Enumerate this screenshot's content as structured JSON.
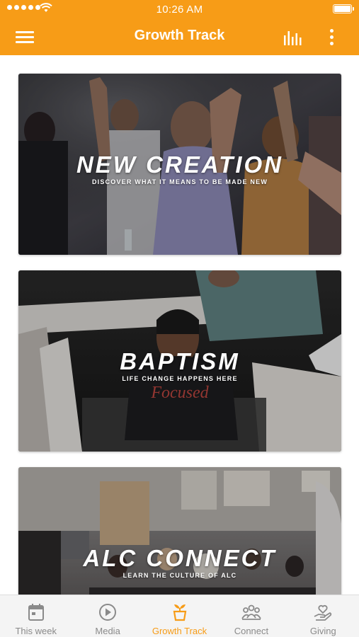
{
  "status_bar": {
    "time": "10:26 AM"
  },
  "header": {
    "title": "Growth Track"
  },
  "cards": [
    {
      "title": "NEW CREATION",
      "subtitle": "DISCOVER WHAT IT MEANS TO BE MADE NEW"
    },
    {
      "title": "BAPTISM",
      "subtitle": "LIFE CHANGE HAPPENS HERE"
    },
    {
      "title": "ALC CONNECT",
      "subtitle": "LEARN THE CULTURE OF ALC"
    }
  ],
  "tabs": [
    {
      "label": "This week",
      "icon": "calendar-icon"
    },
    {
      "label": "Media",
      "icon": "play-icon"
    },
    {
      "label": "Growth Track",
      "icon": "sprout-icon",
      "active": true
    },
    {
      "label": "Connect",
      "icon": "people-icon"
    },
    {
      "label": "Giving",
      "icon": "hand-heart-icon"
    }
  ],
  "colors": {
    "accent": "#f79c17",
    "tab_inactive": "#8a8a8a",
    "tab_bar_bg": "#f4f4f4"
  }
}
